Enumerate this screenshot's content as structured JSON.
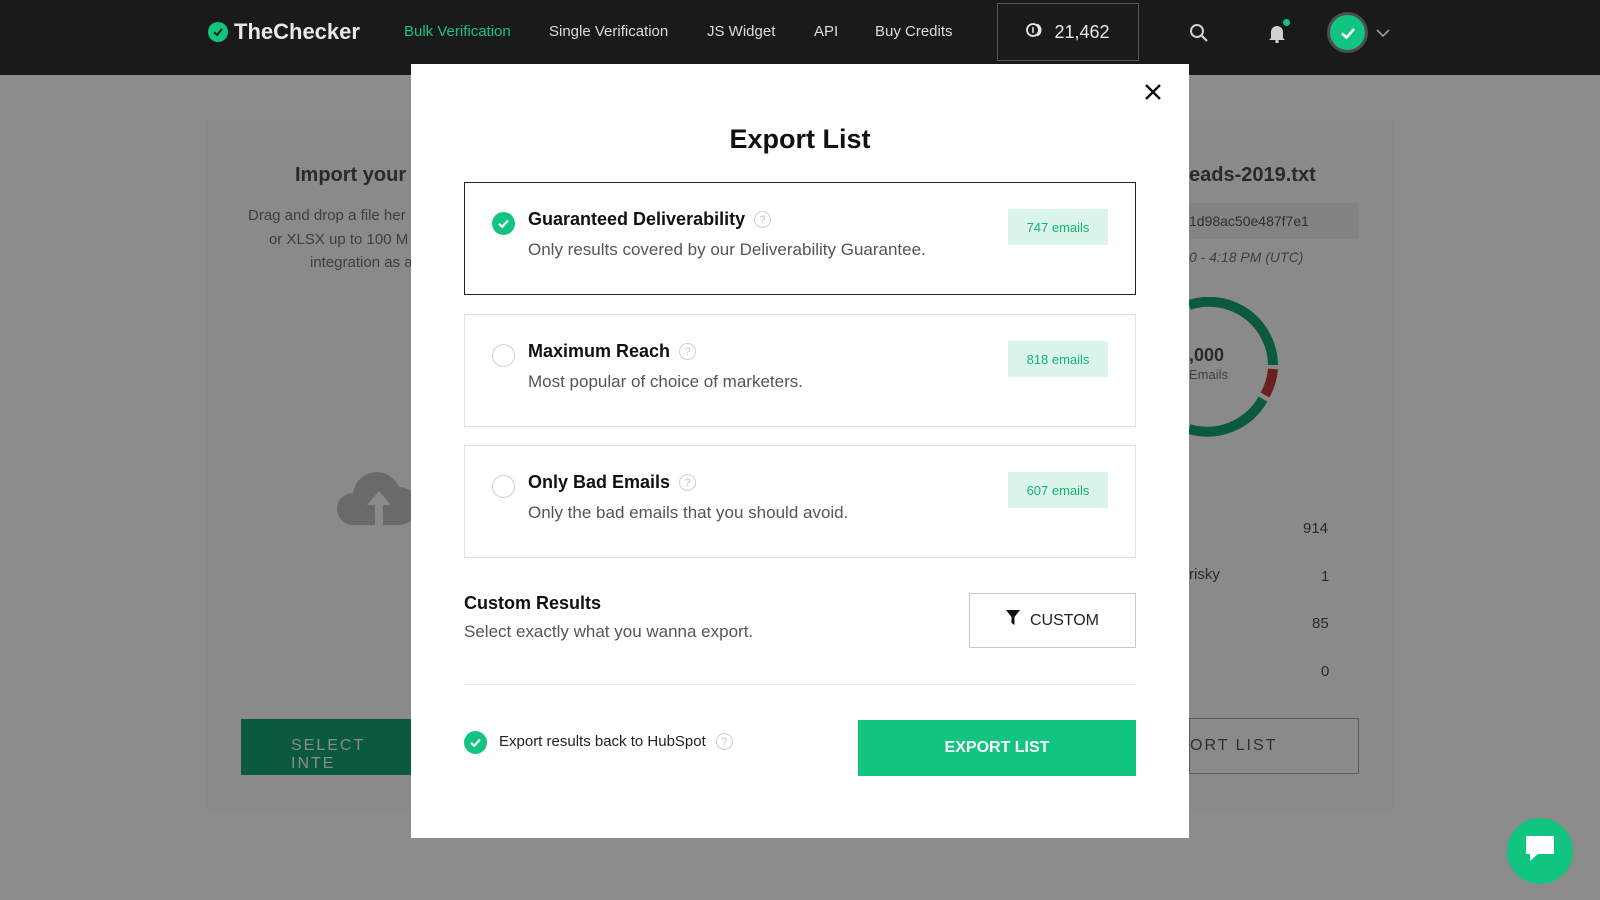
{
  "app": {
    "name": "TheChecker"
  },
  "nav": {
    "links": [
      {
        "label": "Bulk Verification",
        "active": true
      },
      {
        "label": "Single Verification",
        "active": false
      },
      {
        "label": "JS Widget",
        "active": false
      },
      {
        "label": "API",
        "active": false
      },
      {
        "label": "Buy Credits",
        "active": false
      }
    ],
    "credits": "21,462"
  },
  "background": {
    "import_title": "Import your",
    "import_desc": [
      "Drag and drop a file her",
      "or XLSX up to 100 M",
      "integration as a"
    ],
    "select_btn": "SELECT INTE",
    "file_title": "eads-2019.txt",
    "file_hash": "1d98ac50e487f7e1",
    "file_date": "0 - 4:18 PM (UTC)",
    "donut_total": ",000",
    "donut_label": "Emails",
    "stats": [
      {
        "label": "",
        "value": "914"
      },
      {
        "label": "risky",
        "value": "1"
      },
      {
        "label": "",
        "value": "85"
      },
      {
        "label": "",
        "value": "0"
      }
    ],
    "export_btn": "ORT LIST"
  },
  "modal": {
    "title": "Export List",
    "options": [
      {
        "title": "Guaranteed Deliverability",
        "desc": "Only results covered by our Deliverability Guarantee.",
        "badge": "747 emails",
        "selected": true
      },
      {
        "title": "Maximum Reach",
        "desc": "Most popular of choice of marketers.",
        "badge": "818 emails",
        "selected": false
      },
      {
        "title": "Only Bad Emails",
        "desc": "Only the bad emails that you should avoid.",
        "badge": "607 emails",
        "selected": false
      }
    ],
    "custom": {
      "title": "Custom Results",
      "desc": "Select exactly what you wanna export.",
      "button": "CUSTOM"
    },
    "hubspot_label": "Export results back to HubSpot",
    "hubspot_checked": true,
    "export_button": "EXPORT LIST"
  },
  "colors": {
    "accent": "#11c47f",
    "nav_bg": "#1a1a1a",
    "overlay": "#8c8c8c"
  }
}
